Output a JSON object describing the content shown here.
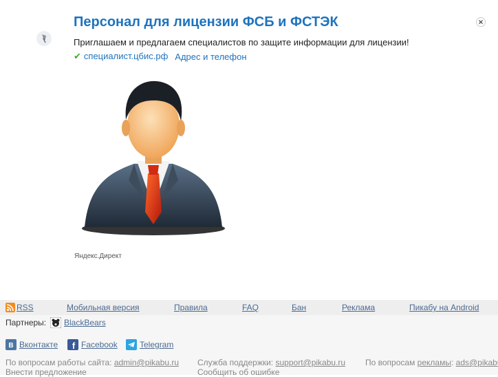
{
  "ad": {
    "title": "Персонал для лицензии ФСБ и ФСТЭК",
    "text": "Приглашаем и предлагаем специалистов по защите информации для лицензии!",
    "link_site": "специалист.цбис.рф",
    "link_contacts": "Адрес и телефон",
    "source": "Яндекс.Директ",
    "icons": {
      "pin": "pin-icon",
      "close": "close-icon",
      "check": "check-icon"
    }
  },
  "footer": {
    "links": [
      "RSS",
      "Мобильная версия",
      "Правила",
      "FAQ",
      "Бан",
      "Реклама",
      "Пикабу на Android"
    ],
    "partners_label": "Партнеры:",
    "partner_name": "BlackBears",
    "social": [
      "Вконтакте",
      "Facebook",
      "Telegram"
    ],
    "contact_work_label": "По вопросам работы сайта:",
    "contact_work_email": "admin@pikabu.ru",
    "contact_support_label": "Служба поддержки:",
    "contact_support_email": "support@pikabu.ru",
    "contact_ads_label": "По вопросам",
    "contact_ads_link": "рекламы",
    "contact_ads_email": "ads@pikabu.ru",
    "suggest": "Внести предложение",
    "report_error": "Сообщить об ошибке"
  },
  "colors": {
    "accent": "#1e73be",
    "footer_link": "#4a6a92",
    "check": "#3fae29"
  }
}
